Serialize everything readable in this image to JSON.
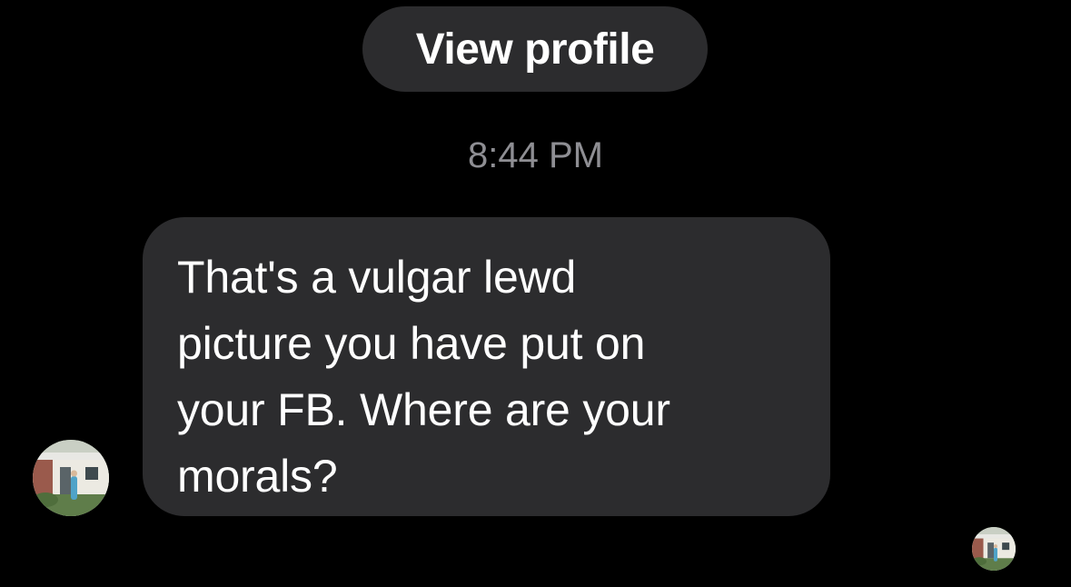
{
  "header": {
    "view_profile_label": "View profile"
  },
  "conversation": {
    "timestamp": "8:44 PM",
    "messages": [
      {
        "text": "That's a vulgar lewd\npicture you have put on\nyour FB.  Where are your\nmorals?"
      }
    ]
  },
  "icons": {
    "sender_avatar": "profile-photo",
    "read_receipt_avatar": "profile-photo"
  },
  "colors": {
    "background": "#000000",
    "bubble": "#2c2c2e",
    "timestamp": "#8e8e93",
    "text": "#ffffff"
  }
}
